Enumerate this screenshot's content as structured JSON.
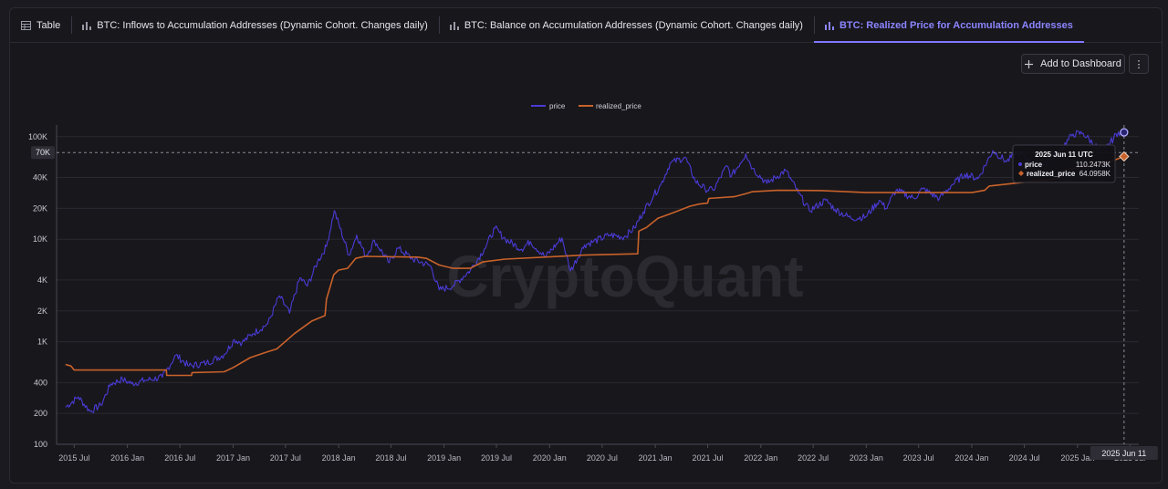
{
  "tabs": [
    {
      "label": "Table",
      "icon": "table-icon",
      "active": false
    },
    {
      "label": "BTC: Inflows to Accumulation Addresses (Dynamic Cohort. Changes daily)",
      "icon": "bar-chart-icon",
      "active": false
    },
    {
      "label": "BTC: Balance on Accumulation Addresses (Dynamic Cohort. Changes daily)",
      "icon": "bar-chart-icon",
      "active": false
    },
    {
      "label": "BTC: Realized Price for Accumulation Addresses",
      "icon": "bar-chart-icon",
      "active": true
    }
  ],
  "toolbar": {
    "add_label": "Add to Dashboard",
    "more_label": "⋮"
  },
  "watermark": "CryptoQuant",
  "tooltip": {
    "date": "2025 Jun 11 UTC",
    "rows": [
      {
        "name": "price",
        "value": "110.2473K"
      },
      {
        "name": "realized_price",
        "value": "64.0958K"
      }
    ]
  },
  "crosshair": {
    "x_label": "2025 Jun 11",
    "y_label": "70K",
    "y_value": 70000
  },
  "colors": {
    "price": "#4a3bd6",
    "realized_price": "#c8622a",
    "accent": "#7f78ff"
  },
  "chart_data": {
    "type": "line",
    "y_scale": "log",
    "ylim": [
      100,
      130000
    ],
    "xlim": [
      "2015-05-01",
      "2025-08-01"
    ],
    "legend": "top-center",
    "grid": true,
    "y_ticks": [
      {
        "value": 100,
        "label": "100"
      },
      {
        "value": 200,
        "label": "200"
      },
      {
        "value": 400,
        "label": "400"
      },
      {
        "value": 1000,
        "label": "1K"
      },
      {
        "value": 2000,
        "label": "2K"
      },
      {
        "value": 4000,
        "label": "4K"
      },
      {
        "value": 10000,
        "label": "10K"
      },
      {
        "value": 20000,
        "label": "20K"
      },
      {
        "value": 40000,
        "label": "40K"
      },
      {
        "value": 100000,
        "label": "100K"
      }
    ],
    "x_ticks": [
      {
        "date": "2015-07-01",
        "label": "2015 Jul"
      },
      {
        "date": "2016-01-01",
        "label": "2016 Jan"
      },
      {
        "date": "2016-07-01",
        "label": "2016 Jul"
      },
      {
        "date": "2017-01-01",
        "label": "2017 Jan"
      },
      {
        "date": "2017-07-01",
        "label": "2017 Jul"
      },
      {
        "date": "2018-01-01",
        "label": "2018 Jan"
      },
      {
        "date": "2018-07-01",
        "label": "2018 Jul"
      },
      {
        "date": "2019-01-01",
        "label": "2019 Jan"
      },
      {
        "date": "2019-07-01",
        "label": "2019 Jul"
      },
      {
        "date": "2020-01-01",
        "label": "2020 Jan"
      },
      {
        "date": "2020-07-01",
        "label": "2020 Jul"
      },
      {
        "date": "2021-01-01",
        "label": "2021 Jan"
      },
      {
        "date": "2021-07-01",
        "label": "2021 Jul"
      },
      {
        "date": "2022-01-01",
        "label": "2022 Jan"
      },
      {
        "date": "2022-07-01",
        "label": "2022 Jul"
      },
      {
        "date": "2023-01-01",
        "label": "2023 Jan"
      },
      {
        "date": "2023-07-01",
        "label": "2023 Jul"
      },
      {
        "date": "2024-01-01",
        "label": "2024 Jan"
      },
      {
        "date": "2024-07-01",
        "label": "2024 Jul"
      },
      {
        "date": "2025-01-01",
        "label": "2025 Jan"
      },
      {
        "date": "2025-07-01",
        "label": "2025 Jul"
      }
    ],
    "series": [
      {
        "name": "price",
        "points": [
          [
            "2015-06-01",
            230
          ],
          [
            "2015-07-15",
            290
          ],
          [
            "2015-08-25",
            210
          ],
          [
            "2015-10-01",
            240
          ],
          [
            "2015-11-05",
            390
          ],
          [
            "2015-12-15",
            430
          ],
          [
            "2016-01-15",
            390
          ],
          [
            "2016-03-01",
            420
          ],
          [
            "2016-05-01",
            450
          ],
          [
            "2016-06-17",
            740
          ],
          [
            "2016-08-01",
            580
          ],
          [
            "2016-10-01",
            620
          ],
          [
            "2016-12-01",
            750
          ],
          [
            "2017-01-05",
            1050
          ],
          [
            "2017-02-01",
            980
          ],
          [
            "2017-03-10",
            1200
          ],
          [
            "2017-05-01",
            1500
          ],
          [
            "2017-06-10",
            2800
          ],
          [
            "2017-07-15",
            1900
          ],
          [
            "2017-08-20",
            4200
          ],
          [
            "2017-09-15",
            3500
          ],
          [
            "2017-10-20",
            6000
          ],
          [
            "2017-11-20",
            8500
          ],
          [
            "2017-12-17",
            19000
          ],
          [
            "2018-02-06",
            7000
          ],
          [
            "2018-03-05",
            11000
          ],
          [
            "2018-04-05",
            6800
          ],
          [
            "2018-05-05",
            9700
          ],
          [
            "2018-06-25",
            5900
          ],
          [
            "2018-07-25",
            8200
          ],
          [
            "2018-09-15",
            6400
          ],
          [
            "2018-11-15",
            5500
          ],
          [
            "2018-12-15",
            3200
          ],
          [
            "2019-02-01",
            3500
          ],
          [
            "2019-04-02",
            5000
          ],
          [
            "2019-05-20",
            8000
          ],
          [
            "2019-06-26",
            12800
          ],
          [
            "2019-08-01",
            10000
          ],
          [
            "2019-09-26",
            8000
          ],
          [
            "2019-10-26",
            9500
          ],
          [
            "2019-12-17",
            6700
          ],
          [
            "2020-02-13",
            10300
          ],
          [
            "2020-03-13",
            4900
          ],
          [
            "2020-05-01",
            8800
          ],
          [
            "2020-06-01",
            9500
          ],
          [
            "2020-07-27",
            11000
          ],
          [
            "2020-09-15",
            10500
          ],
          [
            "2020-10-21",
            12900
          ],
          [
            "2020-11-20",
            18500
          ],
          [
            "2020-12-27",
            27000
          ],
          [
            "2021-01-20",
            34000
          ],
          [
            "2021-02-21",
            55000
          ],
          [
            "2021-04-14",
            63000
          ],
          [
            "2021-05-19",
            37000
          ],
          [
            "2021-06-22",
            31000
          ],
          [
            "2021-07-20",
            30000
          ],
          [
            "2021-09-06",
            52000
          ],
          [
            "2021-09-21",
            41000
          ],
          [
            "2021-11-10",
            68000
          ],
          [
            "2021-12-04",
            49000
          ],
          [
            "2022-01-22",
            35000
          ],
          [
            "2022-03-28",
            47000
          ],
          [
            "2022-05-12",
            28000
          ],
          [
            "2022-06-18",
            19000
          ],
          [
            "2022-08-14",
            24000
          ],
          [
            "2022-09-15",
            19500
          ],
          [
            "2022-11-09",
            16000
          ],
          [
            "2022-12-30",
            16500
          ],
          [
            "2023-02-15",
            24000
          ],
          [
            "2023-03-10",
            20000
          ],
          [
            "2023-04-14",
            30000
          ],
          [
            "2023-06-15",
            25000
          ],
          [
            "2023-07-15",
            31000
          ],
          [
            "2023-09-11",
            25000
          ],
          [
            "2023-10-25",
            34000
          ],
          [
            "2023-12-08",
            43000
          ],
          [
            "2024-01-23",
            39000
          ],
          [
            "2024-03-14",
            73000
          ],
          [
            "2024-05-01",
            57000
          ],
          [
            "2024-06-05",
            71000
          ],
          [
            "2024-08-05",
            54000
          ],
          [
            "2024-09-06",
            53000
          ],
          [
            "2024-10-29",
            72000
          ],
          [
            "2024-12-17",
            106000
          ],
          [
            "2025-01-20",
            108000
          ],
          [
            "2025-03-10",
            78000
          ],
          [
            "2025-04-08",
            76000
          ],
          [
            "2025-05-22",
            111000
          ],
          [
            "2025-06-11",
            110247
          ]
        ]
      },
      {
        "name": "realized_price",
        "points": [
          [
            "2015-06-01",
            600
          ],
          [
            "2015-06-20",
            580
          ],
          [
            "2015-07-01",
            530
          ],
          [
            "2016-05-15",
            530
          ],
          [
            "2016-05-16",
            470
          ],
          [
            "2016-08-10",
            470
          ],
          [
            "2016-08-12",
            500
          ],
          [
            "2016-12-01",
            510
          ],
          [
            "2017-01-01",
            560
          ],
          [
            "2017-03-01",
            700
          ],
          [
            "2017-05-01",
            800
          ],
          [
            "2017-06-01",
            850
          ],
          [
            "2017-08-01",
            1200
          ],
          [
            "2017-10-01",
            1600
          ],
          [
            "2017-11-15",
            1800
          ],
          [
            "2017-11-20",
            2600
          ],
          [
            "2017-12-15",
            4500
          ],
          [
            "2018-01-01",
            5000
          ],
          [
            "2018-02-01",
            5200
          ],
          [
            "2018-03-01",
            6500
          ],
          [
            "2018-04-01",
            6800
          ],
          [
            "2018-10-01",
            6700
          ],
          [
            "2018-11-01",
            6500
          ],
          [
            "2018-12-15",
            5600
          ],
          [
            "2019-02-01",
            5200
          ],
          [
            "2019-04-01",
            5200
          ],
          [
            "2019-05-15",
            6000
          ],
          [
            "2019-08-01",
            6400
          ],
          [
            "2020-05-01",
            7000
          ],
          [
            "2020-11-01",
            7200
          ],
          [
            "2020-11-05",
            12000
          ],
          [
            "2020-12-01",
            13000
          ],
          [
            "2021-01-10",
            16000
          ],
          [
            "2021-03-01",
            18000
          ],
          [
            "2021-05-01",
            21000
          ],
          [
            "2021-06-01",
            22000
          ],
          [
            "2021-07-01",
            22500
          ],
          [
            "2021-07-05",
            25000
          ],
          [
            "2021-10-01",
            26000
          ],
          [
            "2021-11-15",
            28000
          ],
          [
            "2021-12-01",
            29000
          ],
          [
            "2022-03-01",
            30000
          ],
          [
            "2022-08-01",
            29800
          ],
          [
            "2023-01-01",
            28500
          ],
          [
            "2024-01-01",
            28500
          ],
          [
            "2024-02-15",
            30000
          ],
          [
            "2024-03-01",
            33000
          ],
          [
            "2024-07-01",
            36000
          ],
          [
            "2024-10-01",
            38000
          ],
          [
            "2024-11-01",
            40000
          ],
          [
            "2024-11-15",
            47000
          ],
          [
            "2025-01-01",
            50000
          ],
          [
            "2025-03-01",
            53000
          ],
          [
            "2025-05-01",
            58000
          ],
          [
            "2025-06-11",
            64096
          ]
        ]
      }
    ]
  }
}
